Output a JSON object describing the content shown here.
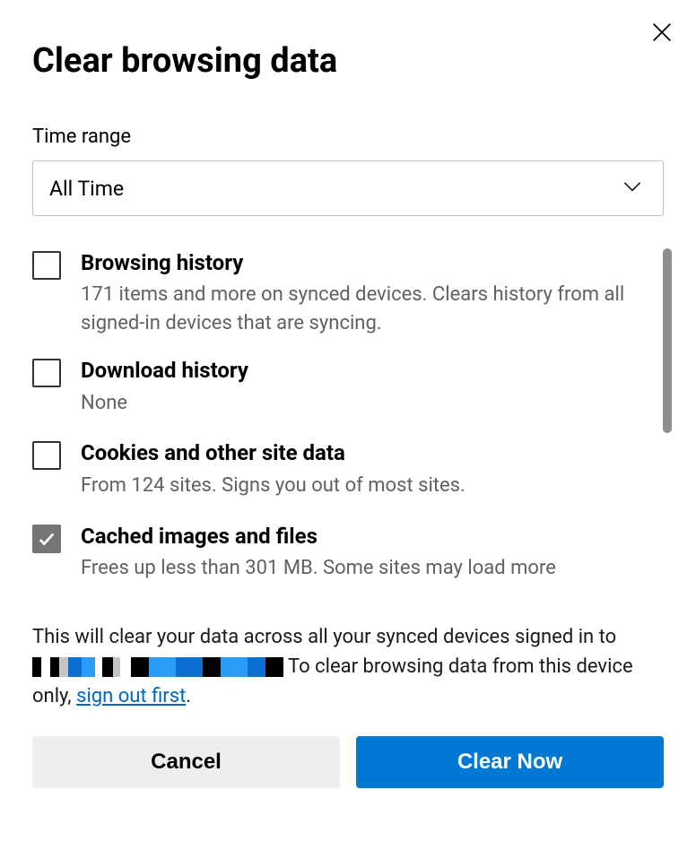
{
  "title": "Clear browsing data",
  "timeRange": {
    "label": "Time range",
    "value": "All Time"
  },
  "items": [
    {
      "checked": false,
      "title": "Browsing history",
      "desc": "171 items and more on synced devices. Clears history from all signed-in devices that are syncing."
    },
    {
      "checked": false,
      "title": "Download history",
      "desc": "None"
    },
    {
      "checked": false,
      "title": "Cookies and other site data",
      "desc": "From 124 sites. Signs you out of most sites."
    },
    {
      "checked": true,
      "title": "Cached images and files",
      "desc": "Frees up less than 301 MB. Some sites may load more"
    }
  ],
  "footer": {
    "part1": "This will clear your data across all your synced devices signed in to ",
    "part2": " To clear browsing data from this device only, ",
    "link": "sign out first",
    "period": "."
  },
  "buttons": {
    "cancel": "Cancel",
    "clear": "Clear Now"
  }
}
